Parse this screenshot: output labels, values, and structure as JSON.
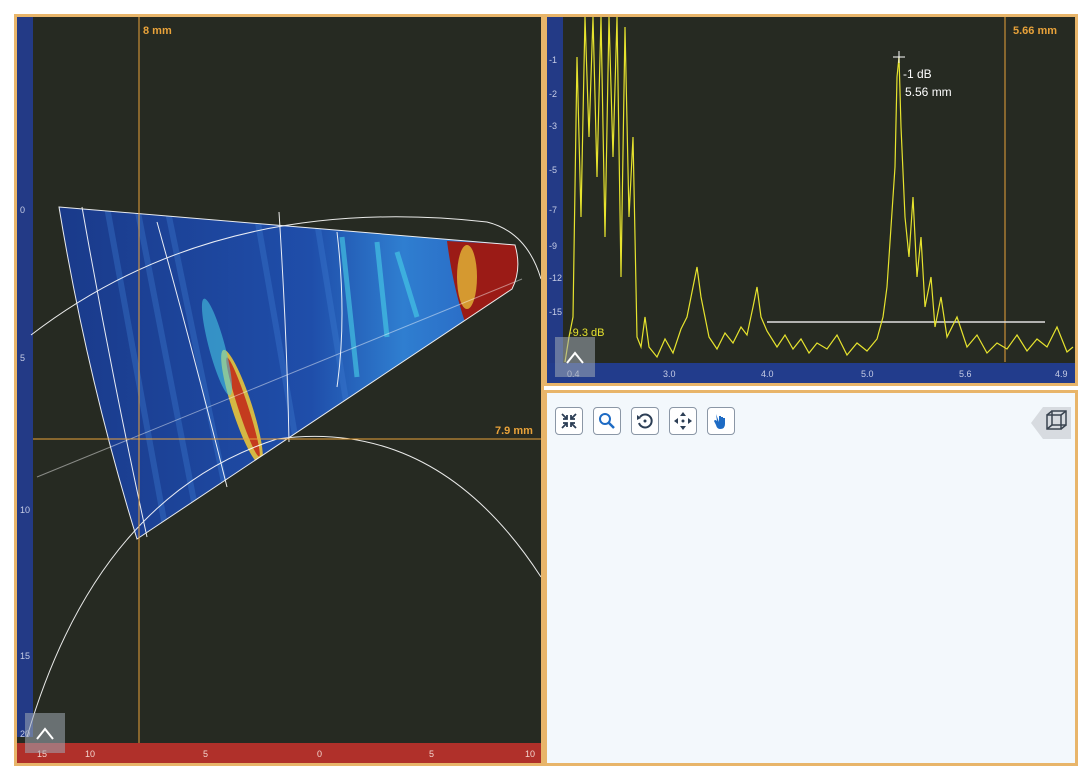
{
  "sscan": {
    "cursor_x_label": "8 mm",
    "cursor_y_label": "7.9 mm",
    "v_ticks": [
      "0",
      "5",
      "10",
      "15",
      "20"
    ],
    "h_ticks": [
      "10",
      "5",
      "0",
      "5",
      "10"
    ],
    "h_edge_left": "15",
    "h_edge_right": "10"
  },
  "ascan": {
    "gate_label": "5.66 mm",
    "peak_db": "-1 dB",
    "peak_depth": "5.56 mm",
    "threshold_label": "-9.3 dB",
    "v_ticks": [
      "-1",
      "-2",
      "-3",
      "-4",
      "-5",
      "-6",
      "-7",
      "-8",
      "-9",
      "-12",
      "-15"
    ],
    "h_ticks": [
      "0.4",
      "3.0",
      "4.0",
      "5.0",
      "5.6",
      "4.9"
    ]
  },
  "toolbar": {
    "buttons": [
      "fit-view",
      "zoom",
      "rotate",
      "pan",
      "select"
    ]
  },
  "colors": {
    "panel_border": "#e8b56a",
    "cursor": "#e8a23a",
    "signal": "#e6e32e",
    "background": "#262a22"
  }
}
